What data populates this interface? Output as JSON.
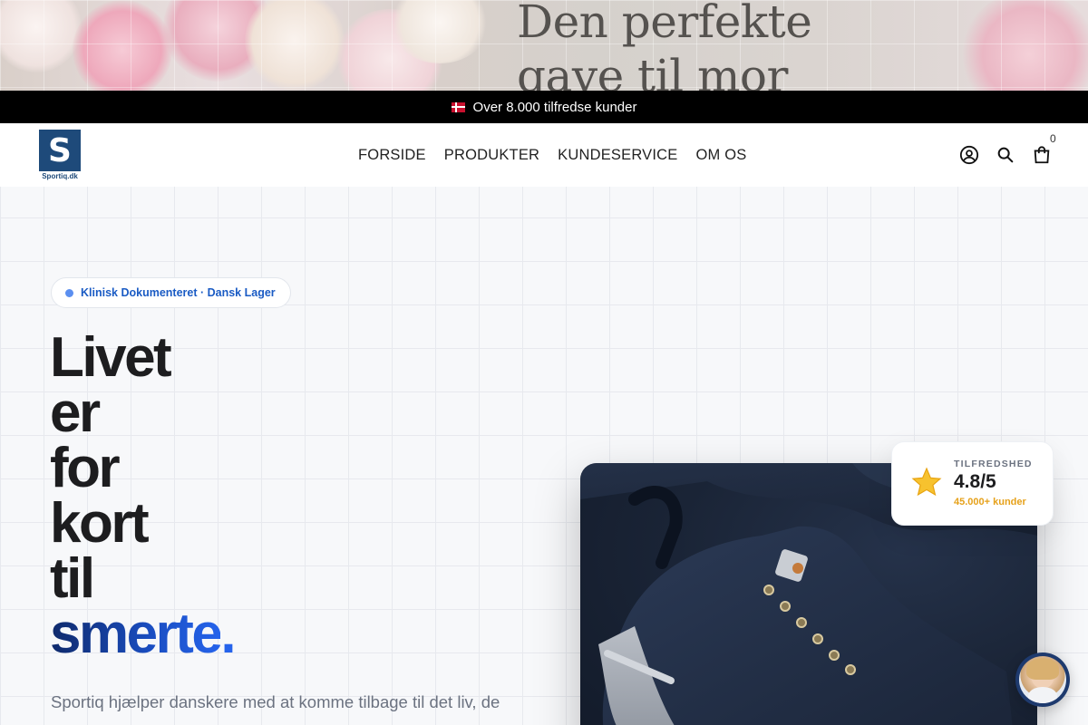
{
  "banner": {
    "line1": "Den perfekte",
    "line2": "gave til mor"
  },
  "announcement": {
    "text": "Over 8.000 tilfredse kunder",
    "flag": "danish-flag-icon"
  },
  "header": {
    "logo_text": "Sportiq.dk",
    "logo_letter": "S",
    "nav": [
      {
        "label": "FORSIDE"
      },
      {
        "label": "PRODUKTER"
      },
      {
        "label": "KUNDESERVICE"
      },
      {
        "label": "OM OS"
      }
    ],
    "icons": [
      "account-icon",
      "search-icon",
      "cart-icon"
    ],
    "cart_count": "0"
  },
  "hero": {
    "badge": "Klinisk Dokumenteret · Dansk Lager",
    "headline_lines": [
      "Livet",
      "er",
      "for",
      "kort",
      "til"
    ],
    "headline_accent": "smerte",
    "headline_dot": ".",
    "subtext": "Sportiq hjælper danskere med at komme tilbage til det liv, de"
  },
  "rating": {
    "label": "TILFREDSHED",
    "score": "4.8/5",
    "sub": "45.000+ kunder",
    "icon": "star-icon"
  },
  "colors": {
    "brand_blue": "#1e4a7a",
    "accent_blue": "#2563eb",
    "badge_text": "#1a5bc4",
    "rating_sub": "#e6a11a"
  }
}
